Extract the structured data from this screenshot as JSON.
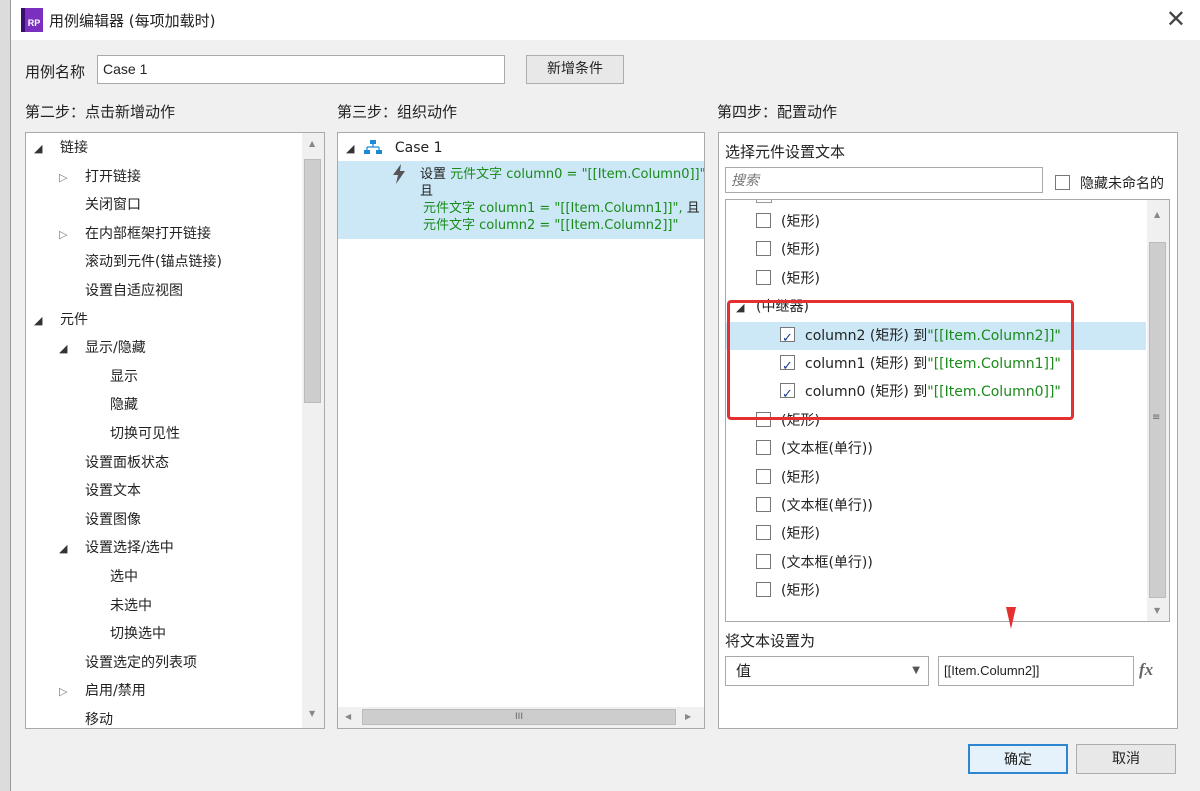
{
  "window": {
    "title": "用例编辑器 (每项加载时)",
    "app_icon": "RP",
    "close_glyph": "✕"
  },
  "case_name": {
    "label": "用例名称",
    "value": "Case 1"
  },
  "add_condition_label": "新增条件",
  "step2": {
    "heading": "第二步：点击新增动作",
    "items": [
      {
        "text": "链接",
        "level": 0,
        "expander": "expanded"
      },
      {
        "text": "打开链接",
        "level": 1,
        "expander": "collapsed"
      },
      {
        "text": "关闭窗口",
        "level": 1,
        "expander": "none"
      },
      {
        "text": "在内部框架打开链接",
        "level": 1,
        "expander": "collapsed"
      },
      {
        "text": "滚动到元件(锚点链接)",
        "level": 1,
        "expander": "none"
      },
      {
        "text": "设置自适应视图",
        "level": 1,
        "expander": "none"
      },
      {
        "text": "元件",
        "level": 0,
        "expander": "expanded"
      },
      {
        "text": "显示/隐藏",
        "level": 1,
        "expander": "expanded"
      },
      {
        "text": "显示",
        "level": 2,
        "expander": "none"
      },
      {
        "text": "隐藏",
        "level": 2,
        "expander": "none"
      },
      {
        "text": "切换可见性",
        "level": 2,
        "expander": "none"
      },
      {
        "text": "设置面板状态",
        "level": 1,
        "expander": "none"
      },
      {
        "text": "设置文本",
        "level": 1,
        "expander": "none"
      },
      {
        "text": "设置图像",
        "level": 1,
        "expander": "none"
      },
      {
        "text": "设置选择/选中",
        "level": 1,
        "expander": "expanded"
      },
      {
        "text": "选中",
        "level": 2,
        "expander": "none"
      },
      {
        "text": "未选中",
        "level": 2,
        "expander": "none"
      },
      {
        "text": "切换选中",
        "level": 2,
        "expander": "none"
      },
      {
        "text": "设置选定的列表项",
        "level": 1,
        "expander": "none"
      },
      {
        "text": "启用/禁用",
        "level": 1,
        "expander": "collapsed"
      },
      {
        "text": "移动",
        "level": 1,
        "expander": "none"
      }
    ]
  },
  "step3": {
    "heading": "第三步：组织动作",
    "case_label": "Case 1",
    "action": {
      "prefix": "设置",
      "line1": "元件文字 column0 = \"[[Item.Column0]]\",",
      "conj1": "且",
      "line2": "元件文字 column1 = \"[[Item.Column1]]\",",
      "conj2": "且",
      "line3": "元件文字 column2 = \"[[Item.Column2]]\""
    },
    "hscroll_grip": "III"
  },
  "step4": {
    "heading": "第四步：配置动作",
    "select_heading": "选择元件设置文本",
    "search_placeholder": "搜索",
    "hide_unnamed_label": "隐藏未命名的",
    "hide_unnamed_checked": false,
    "rows": [
      {
        "text": "(矩形)",
        "checked": false,
        "indent": 1
      },
      {
        "text": "(矩形)",
        "checked": false,
        "indent": 1
      },
      {
        "text": "(矩形)",
        "checked": false,
        "indent": 1
      },
      {
        "text": "(中继器)",
        "group": true,
        "indent": 0
      },
      {
        "name": "column2",
        "type": " (矩形) 到",
        "value": "\"[[Item.Column2]]\"",
        "checked": true,
        "indent": 2,
        "selected": true
      },
      {
        "name": "column1",
        "type": " (矩形) 到",
        "value": "\"[[Item.Column1]]\"",
        "checked": true,
        "indent": 2
      },
      {
        "name": "column0",
        "type": " (矩形) 到",
        "value": "\"[[Item.Column0]]\"",
        "checked": true,
        "indent": 2
      },
      {
        "text": "(矩形)",
        "checked": false,
        "indent": 1
      },
      {
        "text": "(文本框(单行))",
        "checked": false,
        "indent": 1
      },
      {
        "text": "(矩形)",
        "checked": false,
        "indent": 1
      },
      {
        "text": "(文本框(单行))",
        "checked": false,
        "indent": 1
      },
      {
        "text": "(矩形)",
        "checked": false,
        "indent": 1
      },
      {
        "text": "(文本框(单行))",
        "checked": false,
        "indent": 1
      },
      {
        "text": "(矩形)",
        "checked": false,
        "indent": 1
      }
    ],
    "set_text_label": "将文本设置为",
    "value_type": "值",
    "value_input": "[[Item.Column2]]",
    "fx_label": "fx"
  },
  "ok_label": "确定",
  "cancel_label": "取消",
  "annotation_color": "#e53030"
}
